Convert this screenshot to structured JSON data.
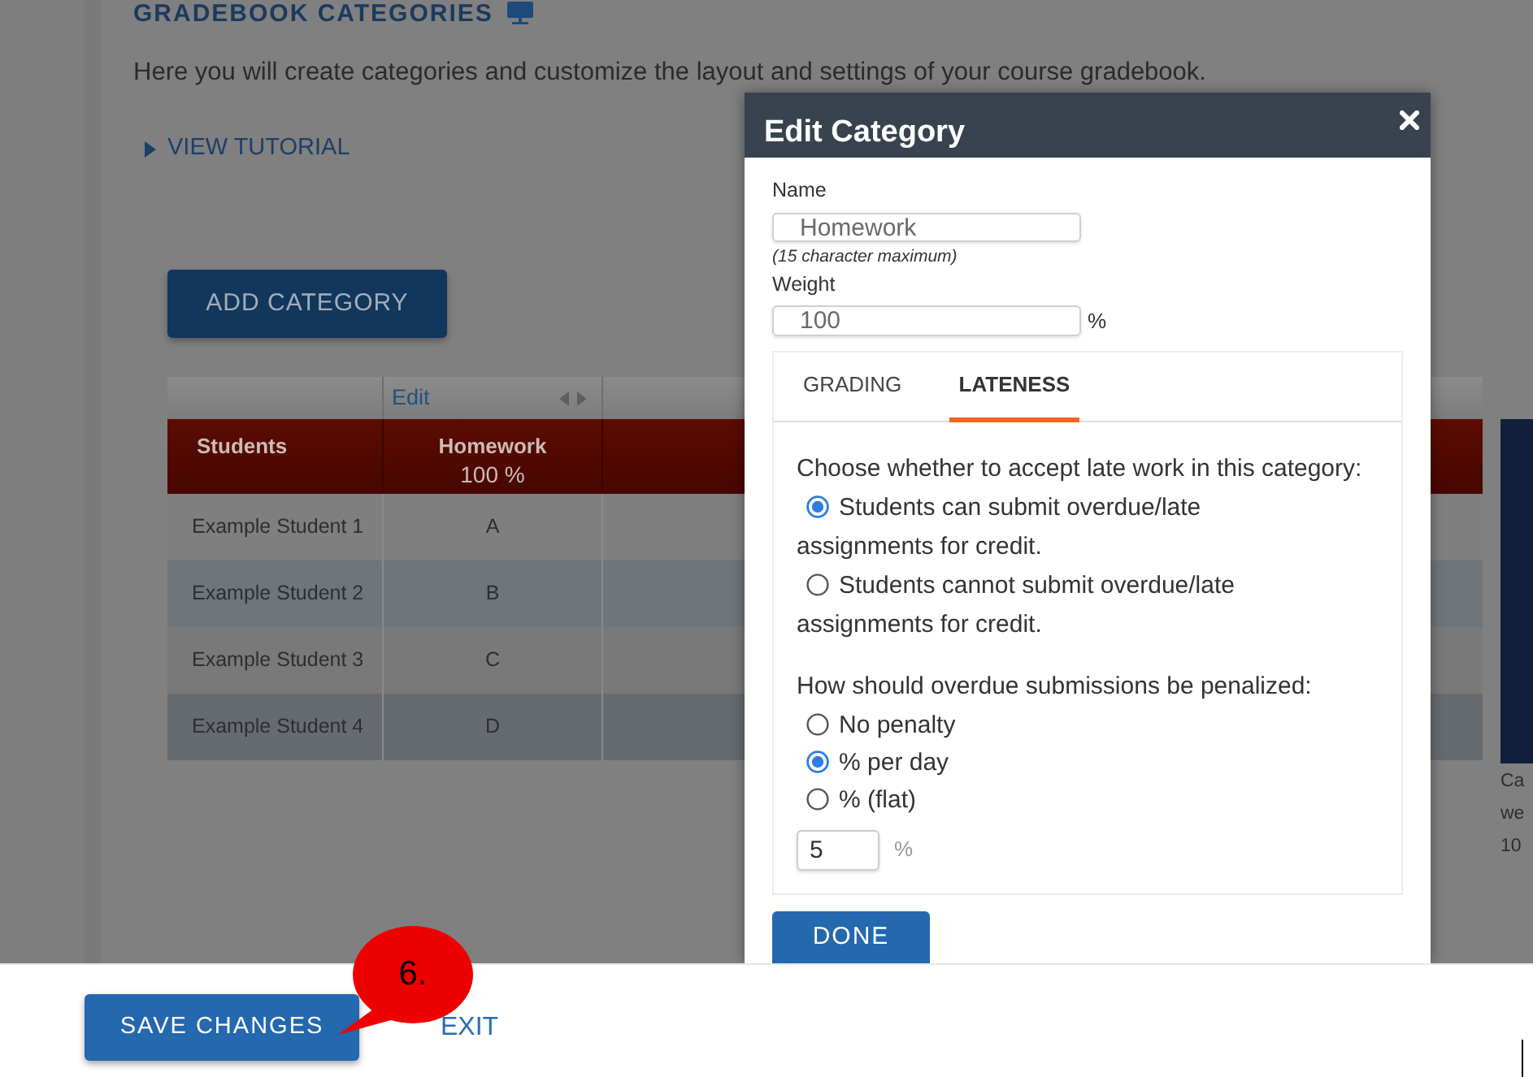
{
  "page": {
    "title": "GRADEBOOK CATEGORIES",
    "intro": "Here you will create categories and customize the layout and settings of your course gradebook.",
    "tutorial_link": "VIEW TUTORIAL",
    "add_button": "ADD CATEGORY"
  },
  "gradebook_table": {
    "edit_link": "Edit",
    "columns": [
      {
        "label": "Students"
      },
      {
        "label": "Homework",
        "weight": "100 %"
      }
    ],
    "rows": [
      {
        "student": "Example Student 1",
        "grade": "A"
      },
      {
        "student": "Example Student 2",
        "grade": "B"
      },
      {
        "student": "Example Student 3",
        "grade": "C"
      },
      {
        "student": "Example Student 4",
        "grade": "D"
      }
    ]
  },
  "side_panel": {
    "lines": [
      "Ca",
      "we",
      "10"
    ]
  },
  "modal": {
    "title": "Edit Category",
    "fields": [
      {
        "label": "Name",
        "value": "Homework",
        "hint": "(15 character maximum)"
      },
      {
        "label": "Weight",
        "value": "100",
        "suffix": "%"
      }
    ],
    "tabs": [
      {
        "label": "GRADING",
        "selected": false
      },
      {
        "label": "LATENESS",
        "selected": true
      }
    ],
    "late_work": {
      "prompt": "Choose whether to accept late work in this category:",
      "options": [
        {
          "label": "Students can submit overdue/late assignments for credit.",
          "selected": true
        },
        {
          "label": "Students cannot submit overdue/late assignments for credit.",
          "selected": false
        }
      ]
    },
    "penalty": {
      "prompt": "How should overdue submissions be penalized:",
      "options": [
        {
          "label": "No penalty",
          "selected": false
        },
        {
          "label": "% per day",
          "selected": true
        },
        {
          "label": "% (flat)",
          "selected": false
        }
      ],
      "amount": {
        "value": "5",
        "suffix": "%"
      }
    },
    "done_button": "DONE"
  },
  "footer": {
    "save_button": "SAVE CHANGES",
    "exit_link": "EXIT"
  },
  "callout": {
    "text": "6."
  }
}
